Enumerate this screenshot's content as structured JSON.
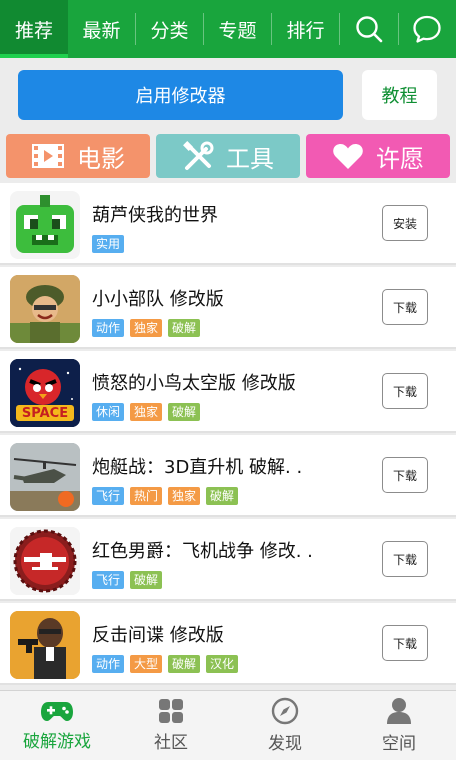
{
  "top_tabs": [
    {
      "label": "推荐"
    },
    {
      "label": "最新"
    },
    {
      "label": "分类"
    },
    {
      "label": "专题"
    },
    {
      "label": "排行"
    }
  ],
  "actions": {
    "enable_label": "启用修改器",
    "tutorial_label": "教程"
  },
  "categories": [
    {
      "label": "电影",
      "icon": "film-icon"
    },
    {
      "label": "工具",
      "icon": "tools-icon"
    },
    {
      "label": "许愿",
      "icon": "heart-icon"
    }
  ],
  "apps": [
    {
      "title": "葫芦侠我的世界",
      "tags": [
        {
          "text": "实用",
          "color": "blue"
        }
      ],
      "button": "安装",
      "icon": "minecraft-creature-icon"
    },
    {
      "title": "小小部队  修改版",
      "tags": [
        {
          "text": "动作",
          "color": "blue"
        },
        {
          "text": "独家",
          "color": "orange"
        },
        {
          "text": "破解",
          "color": "green"
        }
      ],
      "button": "下载",
      "icon": "soldier-icon"
    },
    {
      "title": "愤怒的小鸟太空版  修改版",
      "tags": [
        {
          "text": "休闲",
          "color": "blue"
        },
        {
          "text": "独家",
          "color": "orange"
        },
        {
          "text": "破解",
          "color": "green"
        }
      ],
      "button": "下载",
      "icon": "angry-bird-space-icon"
    },
    {
      "title": "炮艇战：3D直升机  破解. .",
      "tags": [
        {
          "text": "飞行",
          "color": "blue"
        },
        {
          "text": "热门",
          "color": "orange"
        },
        {
          "text": "独家",
          "color": "orange"
        },
        {
          "text": "破解",
          "color": "green"
        }
      ],
      "button": "下载",
      "icon": "helicopter-icon"
    },
    {
      "title": "红色男爵：飞机战争  修改. .",
      "tags": [
        {
          "text": "飞行",
          "color": "blue"
        },
        {
          "text": "破解",
          "color": "green"
        }
      ],
      "button": "下载",
      "icon": "red-baron-plane-icon"
    },
    {
      "title": "反击间谍    修改版",
      "tags": [
        {
          "text": "动作",
          "color": "blue"
        },
        {
          "text": "大型",
          "color": "orange"
        },
        {
          "text": "破解",
          "color": "green"
        },
        {
          "text": "汉化",
          "color": "green"
        }
      ],
      "button": "下载",
      "icon": "spy-icon"
    }
  ],
  "bottom_nav": [
    {
      "label": "破解游戏",
      "icon": "gamepad-icon",
      "active": true
    },
    {
      "label": "社区",
      "icon": "grid-icon",
      "active": false
    },
    {
      "label": "发现",
      "icon": "compass-icon",
      "active": false
    },
    {
      "label": "空间",
      "icon": "person-icon",
      "active": false
    }
  ],
  "colors": {
    "brand_green": "#19a53d",
    "primary_blue": "#1e88e5"
  }
}
